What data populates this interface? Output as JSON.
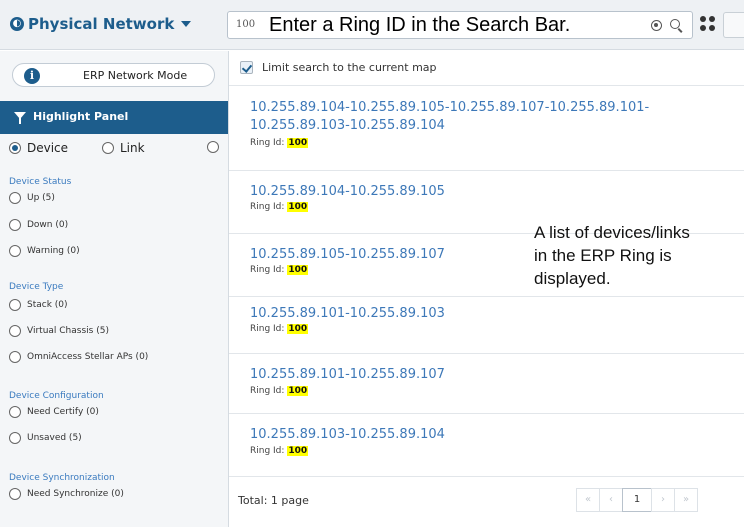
{
  "header": {
    "title": "Physical Network",
    "search_prefix": "100",
    "search_callout": "Enter a Ring ID in the Search Bar."
  },
  "sidebar": {
    "mode_label": "ERP Network Mode",
    "panel_title": "Highlight Panel",
    "tabs": [
      {
        "label": "Device",
        "selected": true
      },
      {
        "label": "Link",
        "selected": false
      }
    ],
    "sections": [
      {
        "title": "Device Status",
        "options": [
          "Up (5)",
          "Down (0)",
          "Warning (0)"
        ]
      },
      {
        "title": "Device Type",
        "options": [
          "Stack (0)",
          "Virtual Chassis (5)",
          "OmniAccess Stellar APs (0)"
        ]
      },
      {
        "title": "Device Configuration",
        "options": [
          "Need Certify (0)",
          "Unsaved (5)"
        ]
      },
      {
        "title": "Device Synchronization",
        "options": [
          "Need Synchronize (0)"
        ]
      }
    ]
  },
  "results": {
    "limit_label": "Limit search to the current map",
    "ring_label": "Ring Id:",
    "items": [
      {
        "line1": "10.255.89.104-10.255.89.105-10.255.89.107-10.255.89.101-",
        "line2": "10.255.89.103-10.255.89.104",
        "ring_id": "100"
      },
      {
        "line1": "10.255.89.104-10.255.89.105",
        "ring_id": "100"
      },
      {
        "line1": "10.255.89.105-10.255.89.107",
        "ring_id": "100"
      },
      {
        "line1": "10.255.89.101-10.255.89.103",
        "ring_id": "100"
      },
      {
        "line1": "10.255.89.101-10.255.89.107",
        "ring_id": "100"
      },
      {
        "line1": "10.255.89.103-10.255.89.104",
        "ring_id": "100"
      }
    ],
    "callout_lines": [
      "A list of devices/links",
      "in the ERP Ring is",
      "displayed."
    ],
    "total": "Total: 1 page",
    "pager": {
      "first": "«",
      "prev": "‹",
      "current": "1",
      "next": "›",
      "last": "»"
    }
  }
}
